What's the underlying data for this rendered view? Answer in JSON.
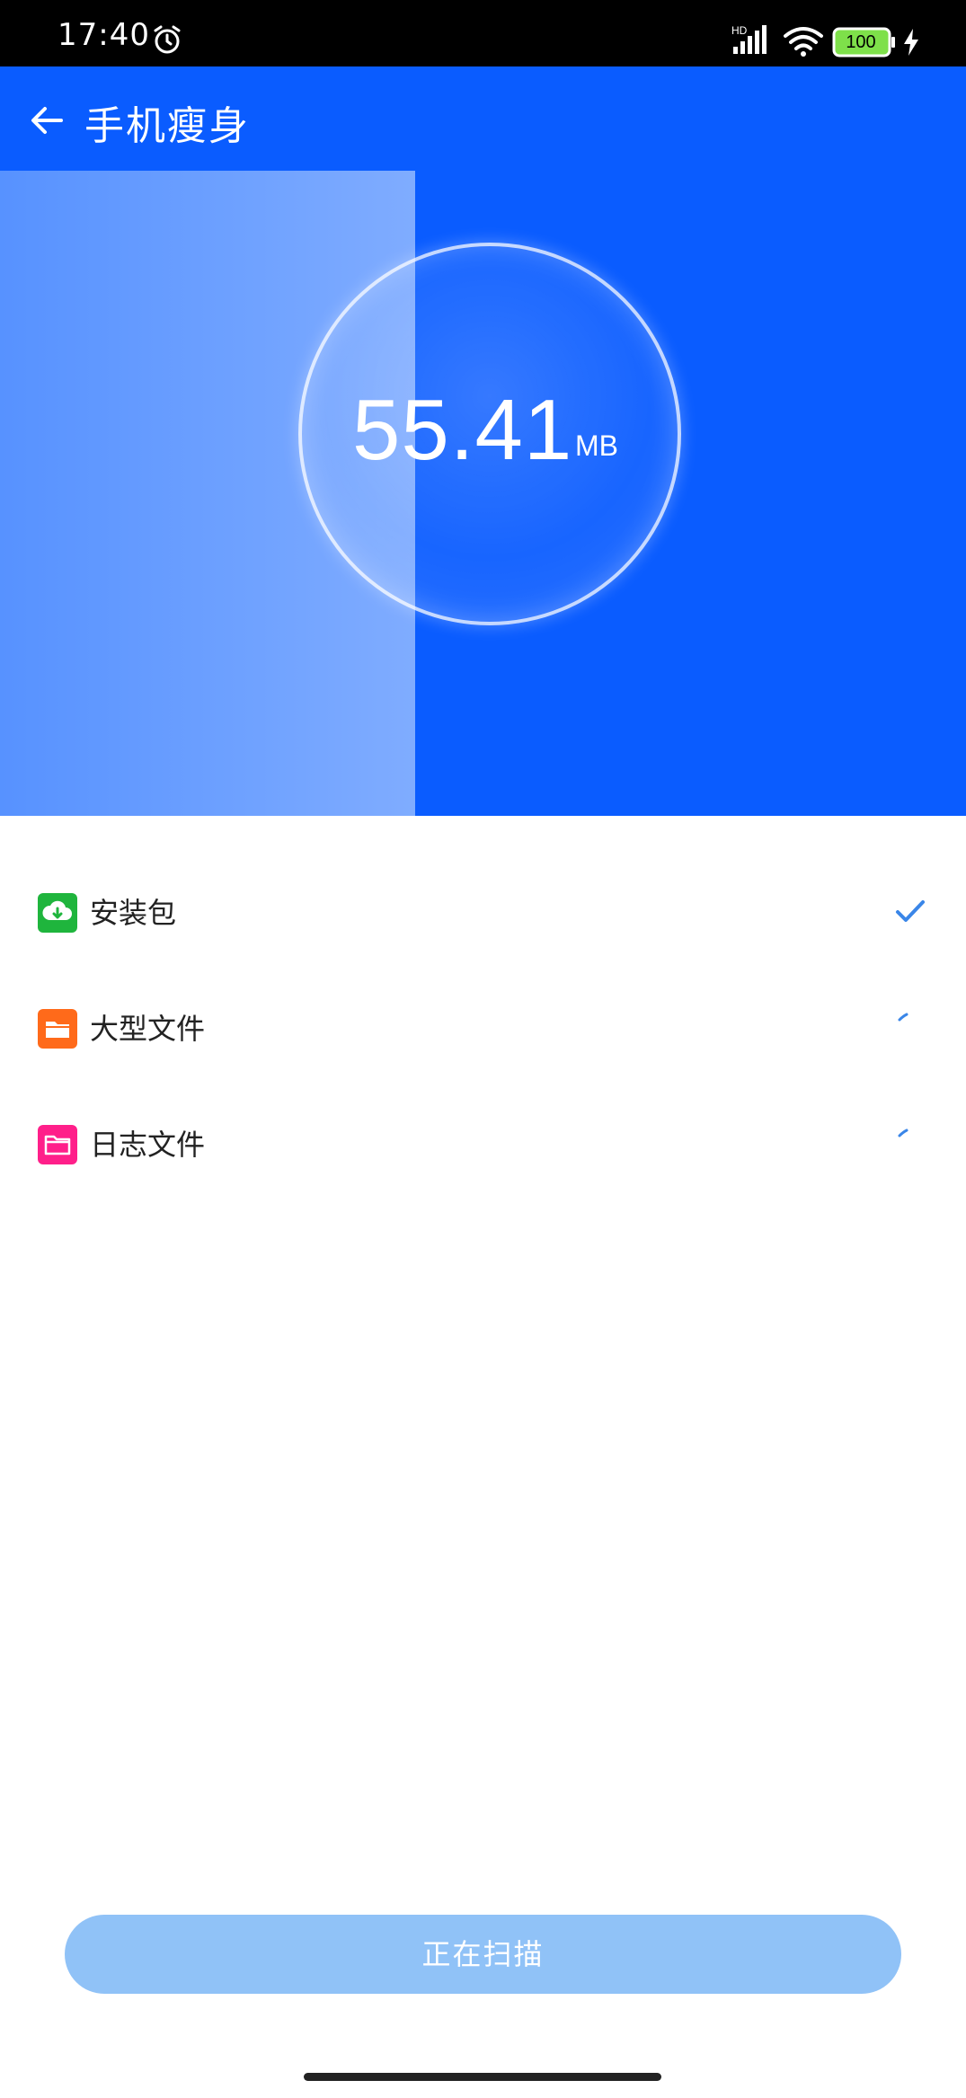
{
  "status_bar": {
    "time": "17:40",
    "network_label": "HD",
    "battery_level": "100",
    "icons": [
      "alarm-clock-icon",
      "cellular-signal-icon",
      "wifi-icon",
      "battery-icon",
      "charging-icon"
    ]
  },
  "header": {
    "title": "手机瘦身",
    "back_icon": "arrow-left-icon"
  },
  "scan_gauge": {
    "value": "55.41",
    "unit": "MB",
    "progress_fraction": 0.43
  },
  "categories": [
    {
      "label": "安装包",
      "icon": "download-cloud-icon",
      "icon_color": "#1fb53d",
      "status": "done"
    },
    {
      "label": "大型文件",
      "icon": "folder-icon",
      "icon_color": "#ff6a1a",
      "status": "scanning"
    },
    {
      "label": "日志文件",
      "icon": "folder-outline-icon",
      "icon_color": "#ff1f8a",
      "status": "scanning"
    }
  ],
  "action_button": {
    "label": "正在扫描"
  },
  "colors": {
    "primary_blue": "#0a5cff",
    "check_blue": "#3a86e8",
    "button_light_blue": "#90c2f7"
  }
}
